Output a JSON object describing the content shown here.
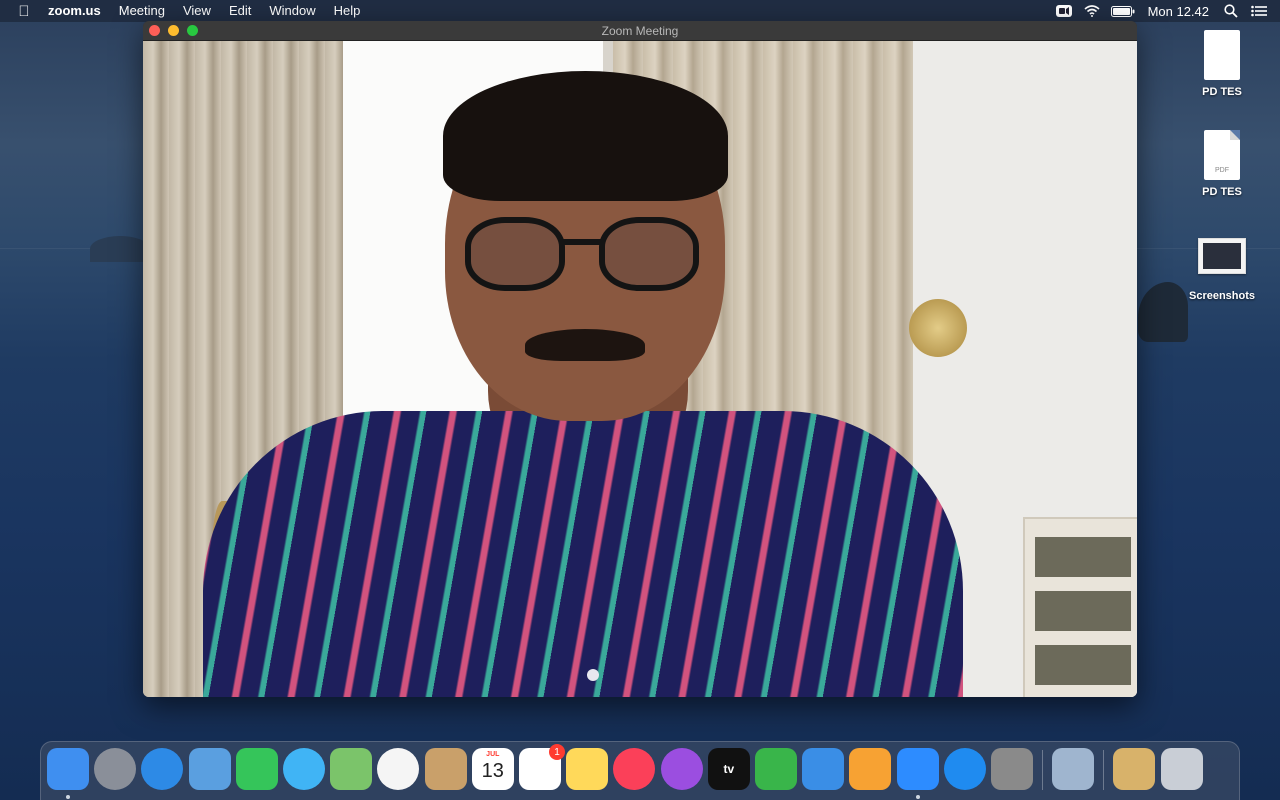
{
  "menubar": {
    "app_name": "zoom.us",
    "menus": [
      "Meeting",
      "View",
      "Edit",
      "Window",
      "Help"
    ],
    "clock": "Mon 12.42",
    "status_icons": [
      "zoom-status-icon",
      "wifi-icon",
      "battery-icon",
      "search-icon",
      "control-center-icon"
    ]
  },
  "zoom_window": {
    "title": "Zoom Meeting"
  },
  "desktop": {
    "icons": [
      {
        "label": "PD TES",
        "kind": "document"
      },
      {
        "label": "PD TES",
        "kind": "pdf",
        "tag": "PDF"
      },
      {
        "label": "Screenshots",
        "kind": "folder"
      }
    ]
  },
  "dock": {
    "apps": [
      {
        "name": "finder",
        "color": "#3f8ff0",
        "running": true
      },
      {
        "name": "launchpad",
        "color": "#8a8f99"
      },
      {
        "name": "safari",
        "color": "#2d8ae6"
      },
      {
        "name": "mail",
        "color": "#5a9fe0"
      },
      {
        "name": "facetime",
        "color": "#35c55a"
      },
      {
        "name": "messages",
        "color": "#40b4f5"
      },
      {
        "name": "maps",
        "color": "#7bc46a"
      },
      {
        "name": "photos",
        "color": "#f5f5f5"
      },
      {
        "name": "contacts",
        "color": "#c9a06a"
      },
      {
        "name": "calendar",
        "color": "#ffffff",
        "month": "JUL",
        "day": "13"
      },
      {
        "name": "reminders",
        "color": "#ffffff",
        "badge": "1"
      },
      {
        "name": "notes",
        "color": "#ffd95a"
      },
      {
        "name": "music",
        "color": "#fb4059"
      },
      {
        "name": "podcasts",
        "color": "#9b4ee0"
      },
      {
        "name": "apple-tv",
        "color": "#111111",
        "label": "tv"
      },
      {
        "name": "numbers",
        "color": "#39b54a"
      },
      {
        "name": "keynote",
        "color": "#3a8ee6"
      },
      {
        "name": "pages",
        "color": "#f7a233"
      },
      {
        "name": "zoom",
        "color": "#2d8cff",
        "running": true
      },
      {
        "name": "app-store",
        "color": "#1f8bf0"
      },
      {
        "name": "system-preferences",
        "color": "#8a8a8a"
      },
      {
        "name": "preview",
        "color": "#9fb5cf"
      },
      {
        "name": "archive-utility",
        "color": "#d8b26a"
      },
      {
        "name": "trash",
        "color": "#c9ced6"
      }
    ]
  }
}
